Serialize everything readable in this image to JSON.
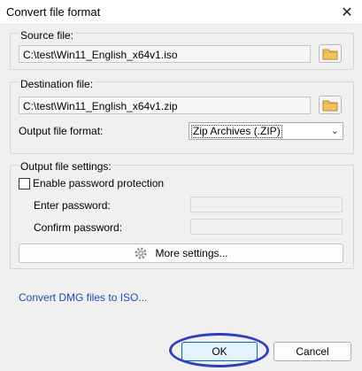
{
  "window": {
    "title": "Convert file format",
    "close_label": "✕"
  },
  "source": {
    "label": "Source file:",
    "path": "C:\\test\\Win11_English_x64v1.iso"
  },
  "destination": {
    "label": "Destination file:",
    "path": "C:\\test\\Win11_English_x64v1.zip",
    "format_label": "Output file format:",
    "format_value": "Zip Archives (.ZIP)"
  },
  "output_settings": {
    "label": "Output file settings:",
    "enable_password_label": "Enable password protection",
    "enable_password_checked": false,
    "enter_password_label": "Enter password:",
    "confirm_password_label": "Confirm password:",
    "more_settings_label": "More settings..."
  },
  "dmg_link": "Convert DMG files to ISO...",
  "buttons": {
    "ok": "OK",
    "cancel": "Cancel"
  },
  "colors": {
    "link": "#1a4bb5",
    "highlight_ring": "#2f3dbf",
    "folder": "#e8b84a"
  },
  "icons": {
    "browse": "folder-icon",
    "settings": "gear-icon",
    "close": "close-icon",
    "dropdown": "chevron-down-icon"
  }
}
